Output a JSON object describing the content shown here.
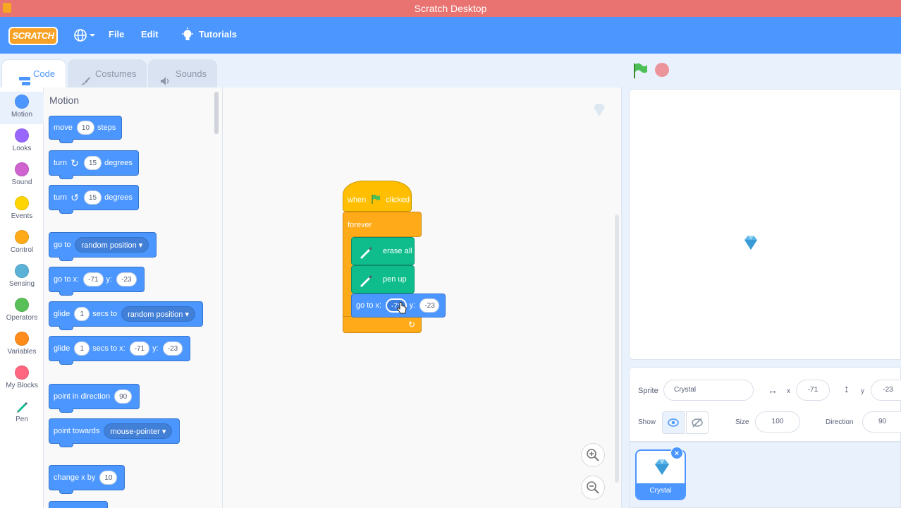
{
  "window": {
    "title": "Scratch Desktop"
  },
  "menubar": {
    "logo": "SCRATCH",
    "file": "File",
    "edit": "Edit",
    "tutorials": "Tutorials"
  },
  "tabs": [
    {
      "label": "Code"
    },
    {
      "label": "Costumes"
    },
    {
      "label": "Sounds"
    }
  ],
  "categories": [
    {
      "label": "Motion",
      "color": "#4c97ff"
    },
    {
      "label": "Looks",
      "color": "#9966ff"
    },
    {
      "label": "Sound",
      "color": "#cf63cf"
    },
    {
      "label": "Events",
      "color": "#ffd500"
    },
    {
      "label": "Control",
      "color": "#ffab19"
    },
    {
      "label": "Sensing",
      "color": "#5cb1d6"
    },
    {
      "label": "Operators",
      "color": "#59c059"
    },
    {
      "label": "Variables",
      "color": "#ff8c1a"
    },
    {
      "label": "My Blocks",
      "color": "#ff6680"
    },
    {
      "label": "Pen",
      "color": "#0fbd8c"
    }
  ],
  "palette": {
    "section_title": "Motion",
    "move": {
      "a": "move",
      "v": "10",
      "b": "steps"
    },
    "turn_right": {
      "a": "turn",
      "v": "15",
      "b": "degrees"
    },
    "turn_left": {
      "a": "turn",
      "v": "15",
      "b": "degrees"
    },
    "goto": {
      "a": "go to",
      "dd": "random position"
    },
    "goto_xy": {
      "a": "go to x:",
      "x": "-71",
      "b": "y:",
      "y": "-23"
    },
    "glide": {
      "a": "glide",
      "v": "1",
      "b": "secs to",
      "dd": "random position"
    },
    "glide_xy": {
      "a": "glide",
      "v": "1",
      "b": "secs to x:",
      "x": "-71",
      "c": "y:",
      "y": "-23"
    },
    "point_dir": {
      "a": "point in direction",
      "v": "90"
    },
    "point_towards": {
      "a": "point towards",
      "dd": "mouse-pointer"
    },
    "change_x": {
      "a": "change x by",
      "v": "10"
    }
  },
  "script": {
    "hat_when": "when",
    "hat_clicked": "clicked",
    "forever": "forever",
    "erase_all": "erase all",
    "pen_up": "pen up",
    "goto_label": "go to x:",
    "goto_x": "-71",
    "goto_ylabel": "y:",
    "goto_y": "-23",
    "loop_arrow": "↻"
  },
  "sprite_info": {
    "sprite_label": "Sprite",
    "sprite_name": "Crystal",
    "x_label": "x",
    "x_value": "-71",
    "y_label": "y",
    "y_value": "-23",
    "show_label": "Show",
    "size_label": "Size",
    "size_value": "100",
    "direction_label": "Direction",
    "direction_value": "90"
  },
  "sprites": [
    {
      "name": "Crystal"
    }
  ],
  "colors": {
    "accent": "#4c97ff",
    "motion": "#4c97ff",
    "pen": "#0fbd8c",
    "events": "#ffbf00",
    "control": "#ffab19"
  }
}
